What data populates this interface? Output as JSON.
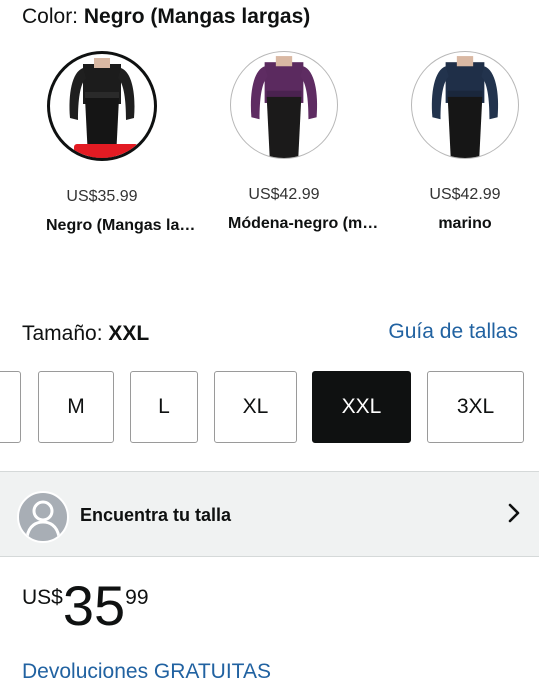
{
  "color_section": {
    "label": "Color:",
    "selected_value": "Negro (Mangas largas)",
    "swatches": [
      {
        "price": "US$35.99",
        "name": "Negro (Mangas la…",
        "dress_color": "#1a1a1a",
        "skirt_color": "#151515",
        "selected": true
      },
      {
        "price": "US$42.99",
        "name": "Módena-negro (m…",
        "dress_color": "#5b2a5f",
        "skirt_color": "#1b1a1a",
        "selected": false
      },
      {
        "price": "US$42.99",
        "name": "marino",
        "dress_color": "#1f2f48",
        "skirt_color": "#161616",
        "selected": false
      }
    ]
  },
  "size_section": {
    "label": "Tamaño:",
    "selected_value": "XXL",
    "guide_link": "Guía de tallas",
    "sizes": [
      "M",
      "L",
      "XL",
      "XXL",
      "3XL"
    ]
  },
  "find_size": {
    "label": "Encuentra tu talla",
    "icon": "user-avatar-icon"
  },
  "price": {
    "currency": "US$",
    "whole": "35",
    "fraction": "99"
  },
  "returns": {
    "text": "Devoluciones GRATUITAS"
  },
  "colors": {
    "link": "#2162a1",
    "selected_bg": "#0f1111",
    "sale_badge": "#e31b23"
  }
}
